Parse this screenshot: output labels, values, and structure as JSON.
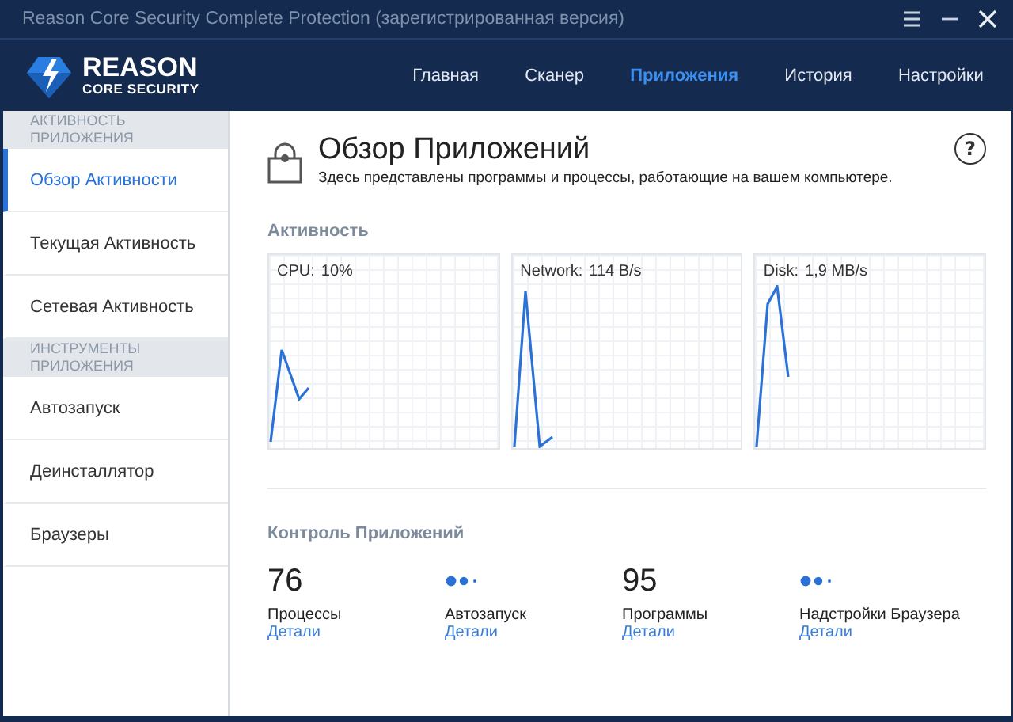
{
  "window": {
    "title": "Reason Core Security Complete Protection (зарегистрированная версия)"
  },
  "logo": {
    "line1": "REASON",
    "line2": "CORE SECURITY"
  },
  "nav": [
    {
      "label": "Главная",
      "selected": false
    },
    {
      "label": "Сканер",
      "selected": false
    },
    {
      "label": "Приложения",
      "selected": true
    },
    {
      "label": "История",
      "selected": false
    },
    {
      "label": "Настройки",
      "selected": false
    }
  ],
  "sidebar": {
    "items": [
      {
        "kind": "header",
        "label": "АКТИВНОСТЬ ПРИЛОЖЕНИЯ"
      },
      {
        "kind": "item",
        "label": "Обзор Активности",
        "selected": true
      },
      {
        "kind": "item",
        "label": "Текущая Активность",
        "selected": false
      },
      {
        "kind": "item",
        "label": "Сетевая Активность",
        "selected": false
      },
      {
        "kind": "header",
        "label": "ИНСТРУМЕНТЫ ПРИЛОЖЕНИЯ"
      },
      {
        "kind": "item",
        "label": "Автозапуск",
        "selected": false
      },
      {
        "kind": "item",
        "label": "Деинсталлятор",
        "selected": false
      },
      {
        "kind": "item",
        "label": "Браузеры",
        "selected": false
      }
    ]
  },
  "page": {
    "help": "?",
    "title": "Обзор Приложений",
    "subtitle": "Здесь представлены программы и процессы, работающие на вашем компьютере."
  },
  "activity": {
    "heading": "Активность",
    "graphs": [
      {
        "label": "CPU:",
        "reading": "10%"
      },
      {
        "label": "Network:",
        "reading": "114 B/s"
      },
      {
        "label": "Disk:",
        "reading": "1,9 MB/s"
      }
    ]
  },
  "control": {
    "heading": "Контроль Приложений",
    "stats": [
      {
        "kind": "number",
        "value": "76",
        "label": "Процессы",
        "link": "Детали"
      },
      {
        "kind": "loading",
        "label": "Автозапуск",
        "link": "Детали"
      },
      {
        "kind": "number",
        "value": "95",
        "label": "Программы",
        "link": "Детали"
      },
      {
        "kind": "loading",
        "label": "Надстройки Браузера",
        "link": "Детали"
      }
    ]
  }
}
